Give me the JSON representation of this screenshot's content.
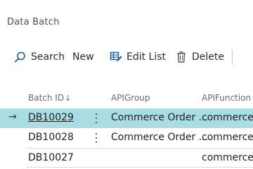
{
  "page": {
    "title": "Data Batch"
  },
  "toolbar": {
    "search_label": "Search",
    "new_label": "New",
    "edit_list_label": "Edit List",
    "delete_label": "Delete"
  },
  "table": {
    "columns": {
      "batch_id": "Batch ID",
      "sort_indicator": "↓",
      "api_group": "APIGroup",
      "api_function": "APIFunction"
    },
    "rows": [
      {
        "batch_id": "DB10029",
        "api_group": "Commerce Order ...",
        "api_function": "commerceU",
        "selected": true
      },
      {
        "batch_id": "DB10028",
        "api_group": "Commerce Order ...",
        "api_function": "commerceU",
        "selected": false
      },
      {
        "batch_id": "DB10027",
        "api_group": "",
        "api_function": "commerceU",
        "selected": false
      }
    ]
  },
  "colors": {
    "selected_row": "#a9dde6",
    "accent": "#1b5e9e"
  },
  "icons": {
    "search": "search-icon",
    "edit_list": "edit-list-icon",
    "delete": "trash-icon",
    "row_menu": "more-vertical-icon",
    "selected_row": "arrow-right-icon"
  }
}
